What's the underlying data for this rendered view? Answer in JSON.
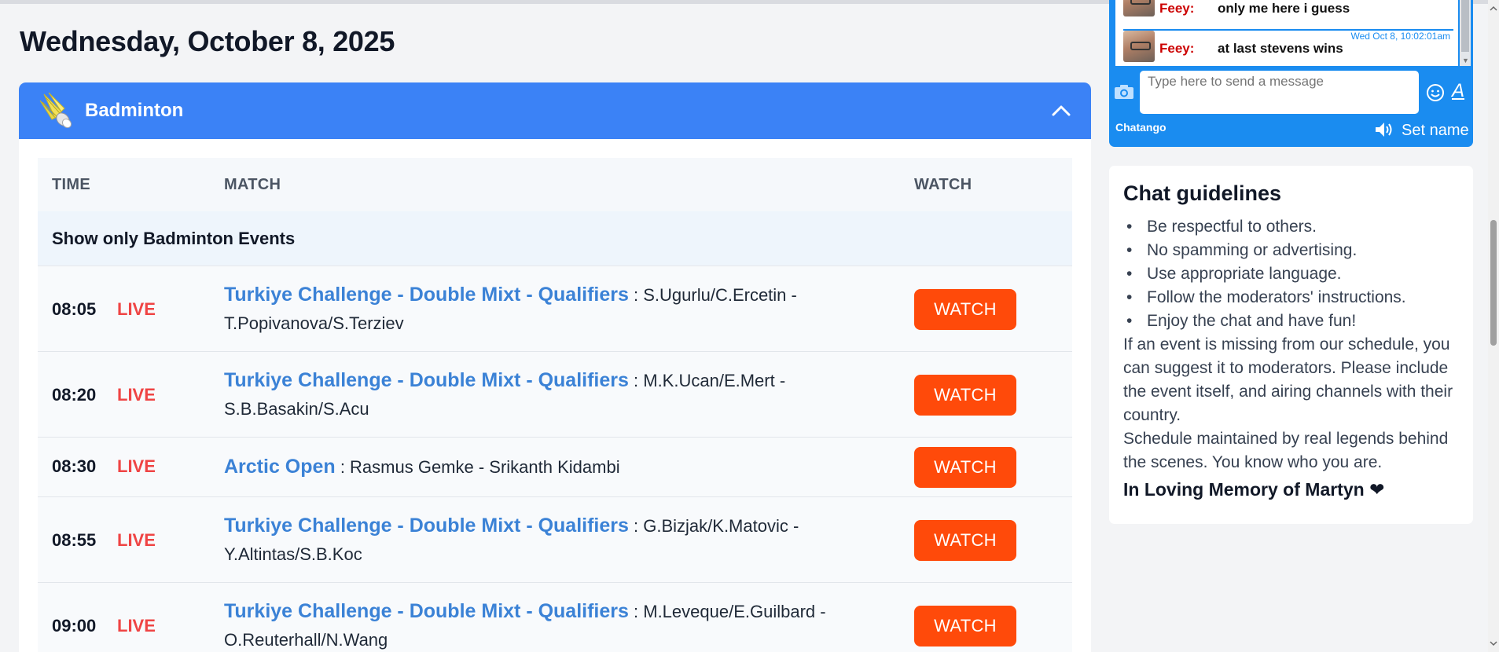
{
  "page": {
    "title": "Wednesday, October 8, 2025"
  },
  "sport": {
    "name": "Badminton",
    "icon": "shuttlecock-icon",
    "header_color": "#3b82f6"
  },
  "table": {
    "headers": {
      "time": "TIME",
      "match": "MATCH",
      "watch": "WATCH"
    },
    "filter_label": "Show only Badminton Events",
    "live_label": "LIVE",
    "watch_label": "WATCH",
    "rows": [
      {
        "time": "08:05",
        "event": "Turkiye Challenge - Double Mixt - Qualifiers",
        "details": " : S.Ugurlu/C.Ercetin - T.Popivanova/S.Terziev"
      },
      {
        "time": "08:20",
        "event": "Turkiye Challenge - Double Mixt - Qualifiers",
        "details": " : M.K.Ucan/E.Mert - S.B.Basakin/S.Acu"
      },
      {
        "time": "08:30",
        "event": "Arctic Open",
        "details": " : Rasmus Gemke - Srikanth Kidambi"
      },
      {
        "time": "08:55",
        "event": "Turkiye Challenge - Double Mixt - Qualifiers",
        "details": " : G.Bizjak/K.Matovic - Y.Altintas/S.B.Koc"
      },
      {
        "time": "09:00",
        "event": "Turkiye Challenge - Double Mixt - Qualifiers",
        "details": " : M.Leveque/E.Guilbard - O.Reuterhall/N.Wang"
      }
    ]
  },
  "chat": {
    "messages": [
      {
        "user": "Feey:",
        "text": "only me here i guess",
        "timestamp": ""
      },
      {
        "user": "Feey:",
        "text": "at last stevens wins",
        "timestamp": "Wed Oct 8, 10:02:01am"
      }
    ],
    "input_placeholder": "Type here to send a message",
    "brand": "Chatango",
    "set_name_label": "Set name",
    "font_button": "A",
    "accent_color": "#1a8cf0"
  },
  "guidelines": {
    "title": "Chat guidelines",
    "items": [
      "Be respectful to others.",
      "No spamming or advertising.",
      "Use appropriate language.",
      "Follow the moderators' instructions.",
      "Enjoy the chat and have fun!"
    ],
    "paragraph1": "If an event is missing from our schedule, you can suggest it to moderators. Please include the event itself, and airing channels with their country.",
    "paragraph2": "Schedule maintained by real legends behind the scenes. You know who you are.",
    "memory": "In Loving Memory of Martyn ❤"
  },
  "colors": {
    "live": "#ef4444",
    "watch_button": "#ff4a0a",
    "event_link": "#3b82d6"
  }
}
